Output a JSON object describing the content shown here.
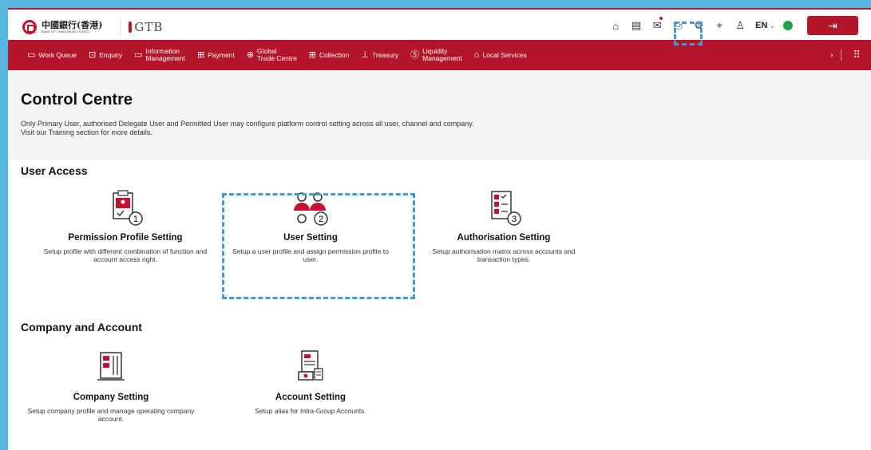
{
  "header": {
    "bank_name_cn": "中國銀行(香港)",
    "bank_name_en": "BANK OF CHINA (HONG KONG)",
    "product_name": "GTB",
    "language": "EN",
    "icons": [
      "home-icon",
      "newspaper-icon",
      "mail-icon",
      "print-icon",
      "gear-icon",
      "location-icon",
      "user-icon",
      "logout-icon"
    ]
  },
  "nav": {
    "items": [
      {
        "label": "Work Queue",
        "icon": "briefcase-icon"
      },
      {
        "label": "Enquiry",
        "icon": "search-doc-icon"
      },
      {
        "label": "Information\nManagement",
        "icon": "folder-icon"
      },
      {
        "label": "Payment",
        "icon": "payment-icon"
      },
      {
        "label": "Global\nTrade Centre",
        "icon": "globe-icon"
      },
      {
        "label": "Collection",
        "icon": "collection-icon"
      },
      {
        "label": "Treasury",
        "icon": "treasury-icon"
      },
      {
        "label": "Liquidity\nManagement",
        "icon": "dollar-icon"
      },
      {
        "label": "Local Services",
        "icon": "bank-icon"
      }
    ]
  },
  "page": {
    "title": "Control Centre",
    "description_line1": "Only Primary User, authorised Delegate User and Permitted User may configure platform control setting across all user, channel and company.",
    "description_line2": "Visit our Training section for more details."
  },
  "user_access": {
    "title": "User Access",
    "cards": [
      {
        "title": "Permission Profile Setting",
        "desc": "Setup profile with different combination of function and account access right.",
        "step": "1"
      },
      {
        "title": "User Setting",
        "desc": "Setup a user profile and assign permission profile to user.",
        "step": "2"
      },
      {
        "title": "Authorisation Setting",
        "desc": "Setup authorisation matrix across accounts and transaction types.",
        "step": "3"
      }
    ]
  },
  "company_account": {
    "title": "Company and Account",
    "cards": [
      {
        "title": "Company Setting",
        "desc": "Setup company profile and manage operating company account."
      },
      {
        "title": "Account Setting",
        "desc": "Setup alias for Intra-Group Accounts."
      }
    ]
  },
  "colors": {
    "brand_red": "#b5152b",
    "highlight_blue": "#3d9ad6",
    "status_green": "#1aa34a"
  }
}
